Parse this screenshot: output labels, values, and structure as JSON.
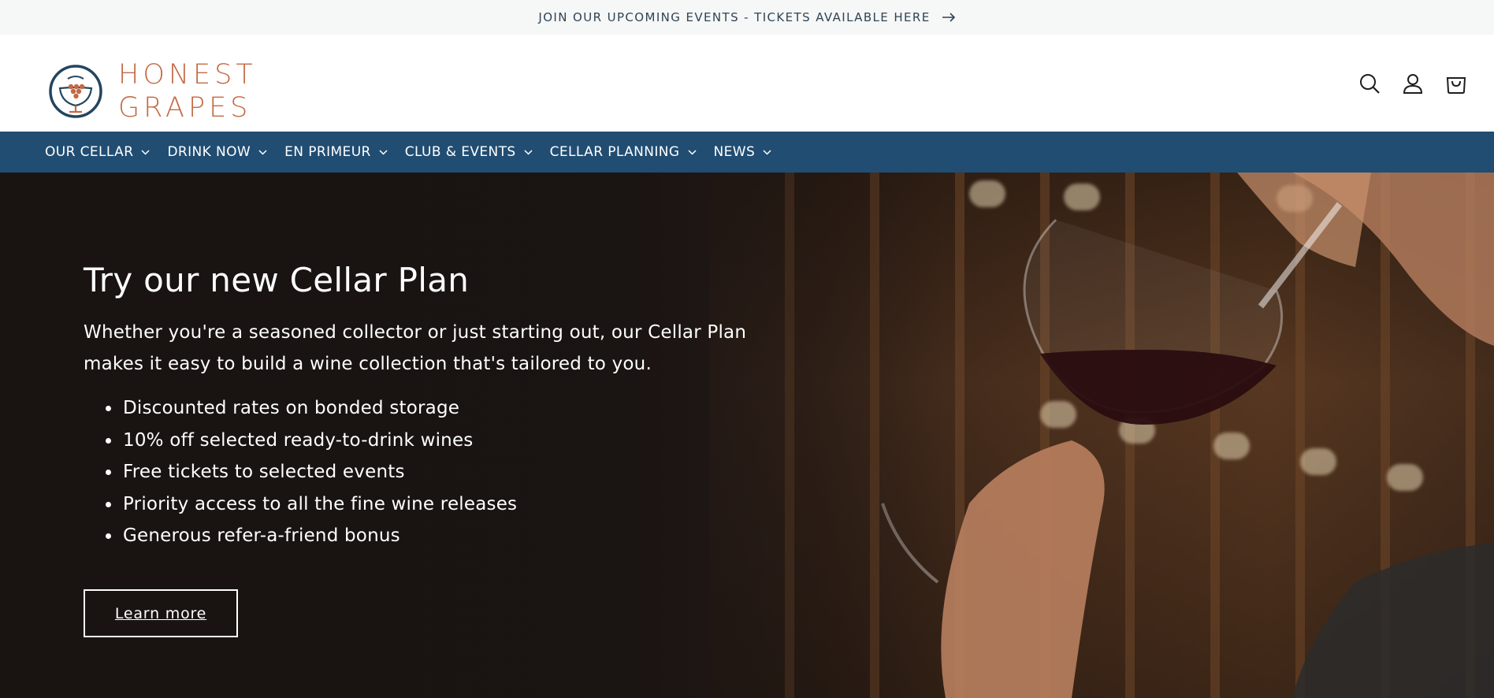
{
  "announcement": {
    "text": "JOIN OUR UPCOMING EVENTS - TICKETS AVAILABLE HERE",
    "icon": "arrow-right-icon"
  },
  "header": {
    "logo_line1": "HONEST",
    "logo_line2": "GRAPES",
    "icons": [
      "search-icon",
      "account-icon",
      "cart-icon"
    ]
  },
  "nav": {
    "items": [
      {
        "label": "OUR CELLAR"
      },
      {
        "label": "DRINK NOW"
      },
      {
        "label": "EN PRIMEUR"
      },
      {
        "label": "CLUB & EVENTS"
      },
      {
        "label": "CELLAR PLANNING"
      },
      {
        "label": "NEWS"
      }
    ]
  },
  "hero": {
    "title": "Try our new Cellar Plan",
    "description": "Whether you're a seasoned collector or just starting out, our Cellar Plan makes it easy to build a wine collection that's tailored to you.",
    "benefits": [
      "Discounted rates on bonded storage",
      "10% off selected ready-to-drink wines",
      "Free tickets to selected events",
      "Priority access to all the fine wine releases",
      "Generous refer-a-friend bonus"
    ],
    "button_label": "Learn more"
  },
  "colors": {
    "brand_orange": "#c46a45",
    "nav_blue": "#214d72",
    "logo_navy": "#24455f",
    "hero_dark": "#1b1514"
  }
}
